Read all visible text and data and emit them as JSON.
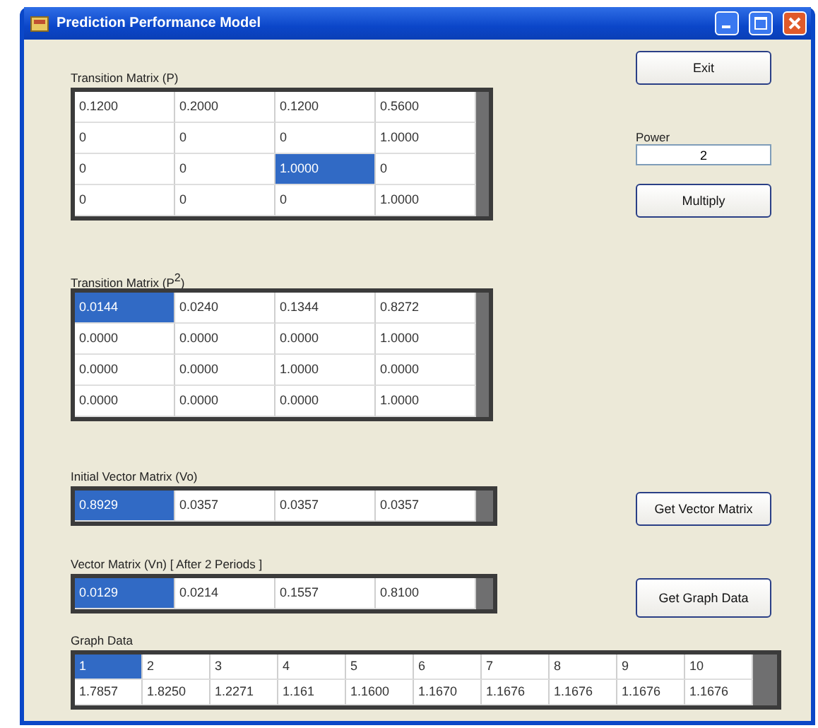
{
  "window": {
    "title": "Prediction Performance Model"
  },
  "exit_button": "Exit",
  "power": {
    "label": "Power",
    "value": "2"
  },
  "multiply_button": "Multiply",
  "transition_matrix": {
    "label": "Transition Matrix (P)",
    "rows": [
      [
        {
          "text": "0.1200",
          "selected": false
        },
        {
          "text": "0.2000",
          "selected": false
        },
        {
          "text": "0.1200",
          "selected": false
        },
        {
          "text": "0.5600",
          "selected": false
        }
      ],
      [
        {
          "text": "0",
          "selected": false
        },
        {
          "text": "0",
          "selected": false
        },
        {
          "text": "0",
          "selected": false
        },
        {
          "text": "1.0000",
          "selected": false
        }
      ],
      [
        {
          "text": "0",
          "selected": false
        },
        {
          "text": "0",
          "selected": false
        },
        {
          "text": "1.0000",
          "selected": true
        },
        {
          "text": "0",
          "selected": false
        }
      ],
      [
        {
          "text": "0",
          "selected": false
        },
        {
          "text": "0",
          "selected": false
        },
        {
          "text": "0",
          "selected": false
        },
        {
          "text": "1.0000",
          "selected": false
        }
      ]
    ]
  },
  "transition_matrix_power": {
    "label": "Transition Matrix (P$^{2}$)",
    "rows": [
      [
        {
          "text": "0.0144",
          "selected": true
        },
        {
          "text": "0.0240",
          "selected": false
        },
        {
          "text": "0.1344",
          "selected": false
        },
        {
          "text": "0.8272",
          "selected": false
        }
      ],
      [
        {
          "text": "0.0000",
          "selected": false
        },
        {
          "text": "0.0000",
          "selected": false
        },
        {
          "text": "0.0000",
          "selected": false
        },
        {
          "text": "1.0000",
          "selected": false
        }
      ],
      [
        {
          "text": "0.0000",
          "selected": false
        },
        {
          "text": "0.0000",
          "selected": false
        },
        {
          "text": "1.0000",
          "selected": false
        },
        {
          "text": "0.0000",
          "selected": false
        }
      ],
      [
        {
          "text": "0.0000",
          "selected": false
        },
        {
          "text": "0.0000",
          "selected": false
        },
        {
          "text": "0.0000",
          "selected": false
        },
        {
          "text": "1.0000",
          "selected": false
        }
      ]
    ]
  },
  "initial_vector": {
    "label": "Initial Vector Matrix (Vo)",
    "rows": [
      [
        {
          "text": "0.8929",
          "selected": true
        },
        {
          "text": "0.0357",
          "selected": false
        },
        {
          "text": "0.0357",
          "selected": false
        },
        {
          "text": "0.0357",
          "selected": false
        }
      ]
    ]
  },
  "get_vector_button": "Get Vector Matrix",
  "vector_after": {
    "label": "Vector Matrix (Vn) [ After 2 Periods ]",
    "rows": [
      [
        {
          "text": "0.0129",
          "selected": true
        },
        {
          "text": "0.0214",
          "selected": false
        },
        {
          "text": "0.1557",
          "selected": false
        },
        {
          "text": "0.8100",
          "selected": false
        }
      ]
    ]
  },
  "get_graph_button": "Get Graph Data",
  "graph_data": {
    "label": "Graph Data",
    "rows": [
      [
        {
          "text": "1",
          "selected": true
        },
        {
          "text": "2",
          "selected": false
        },
        {
          "text": "3",
          "selected": false
        },
        {
          "text": "4",
          "selected": false
        },
        {
          "text": "5",
          "selected": false
        },
        {
          "text": "6",
          "selected": false
        },
        {
          "text": "7",
          "selected": false
        },
        {
          "text": "8",
          "selected": false
        },
        {
          "text": "9",
          "selected": false
        },
        {
          "text": "10",
          "selected": false
        }
      ],
      [
        {
          "text": "1.7857",
          "selected": false
        },
        {
          "text": "1.8250",
          "selected": false
        },
        {
          "text": "1.2271",
          "selected": false
        },
        {
          "text": "1.161",
          "selected": false
        },
        {
          "text": "1.1600",
          "selected": false
        },
        {
          "text": "1.1670",
          "selected": false
        },
        {
          "text": "1.1676",
          "selected": false
        },
        {
          "text": "1.1676",
          "selected": false
        },
        {
          "text": "1.1676",
          "selected": false
        },
        {
          "text": "1.1676",
          "selected": false
        }
      ]
    ]
  }
}
